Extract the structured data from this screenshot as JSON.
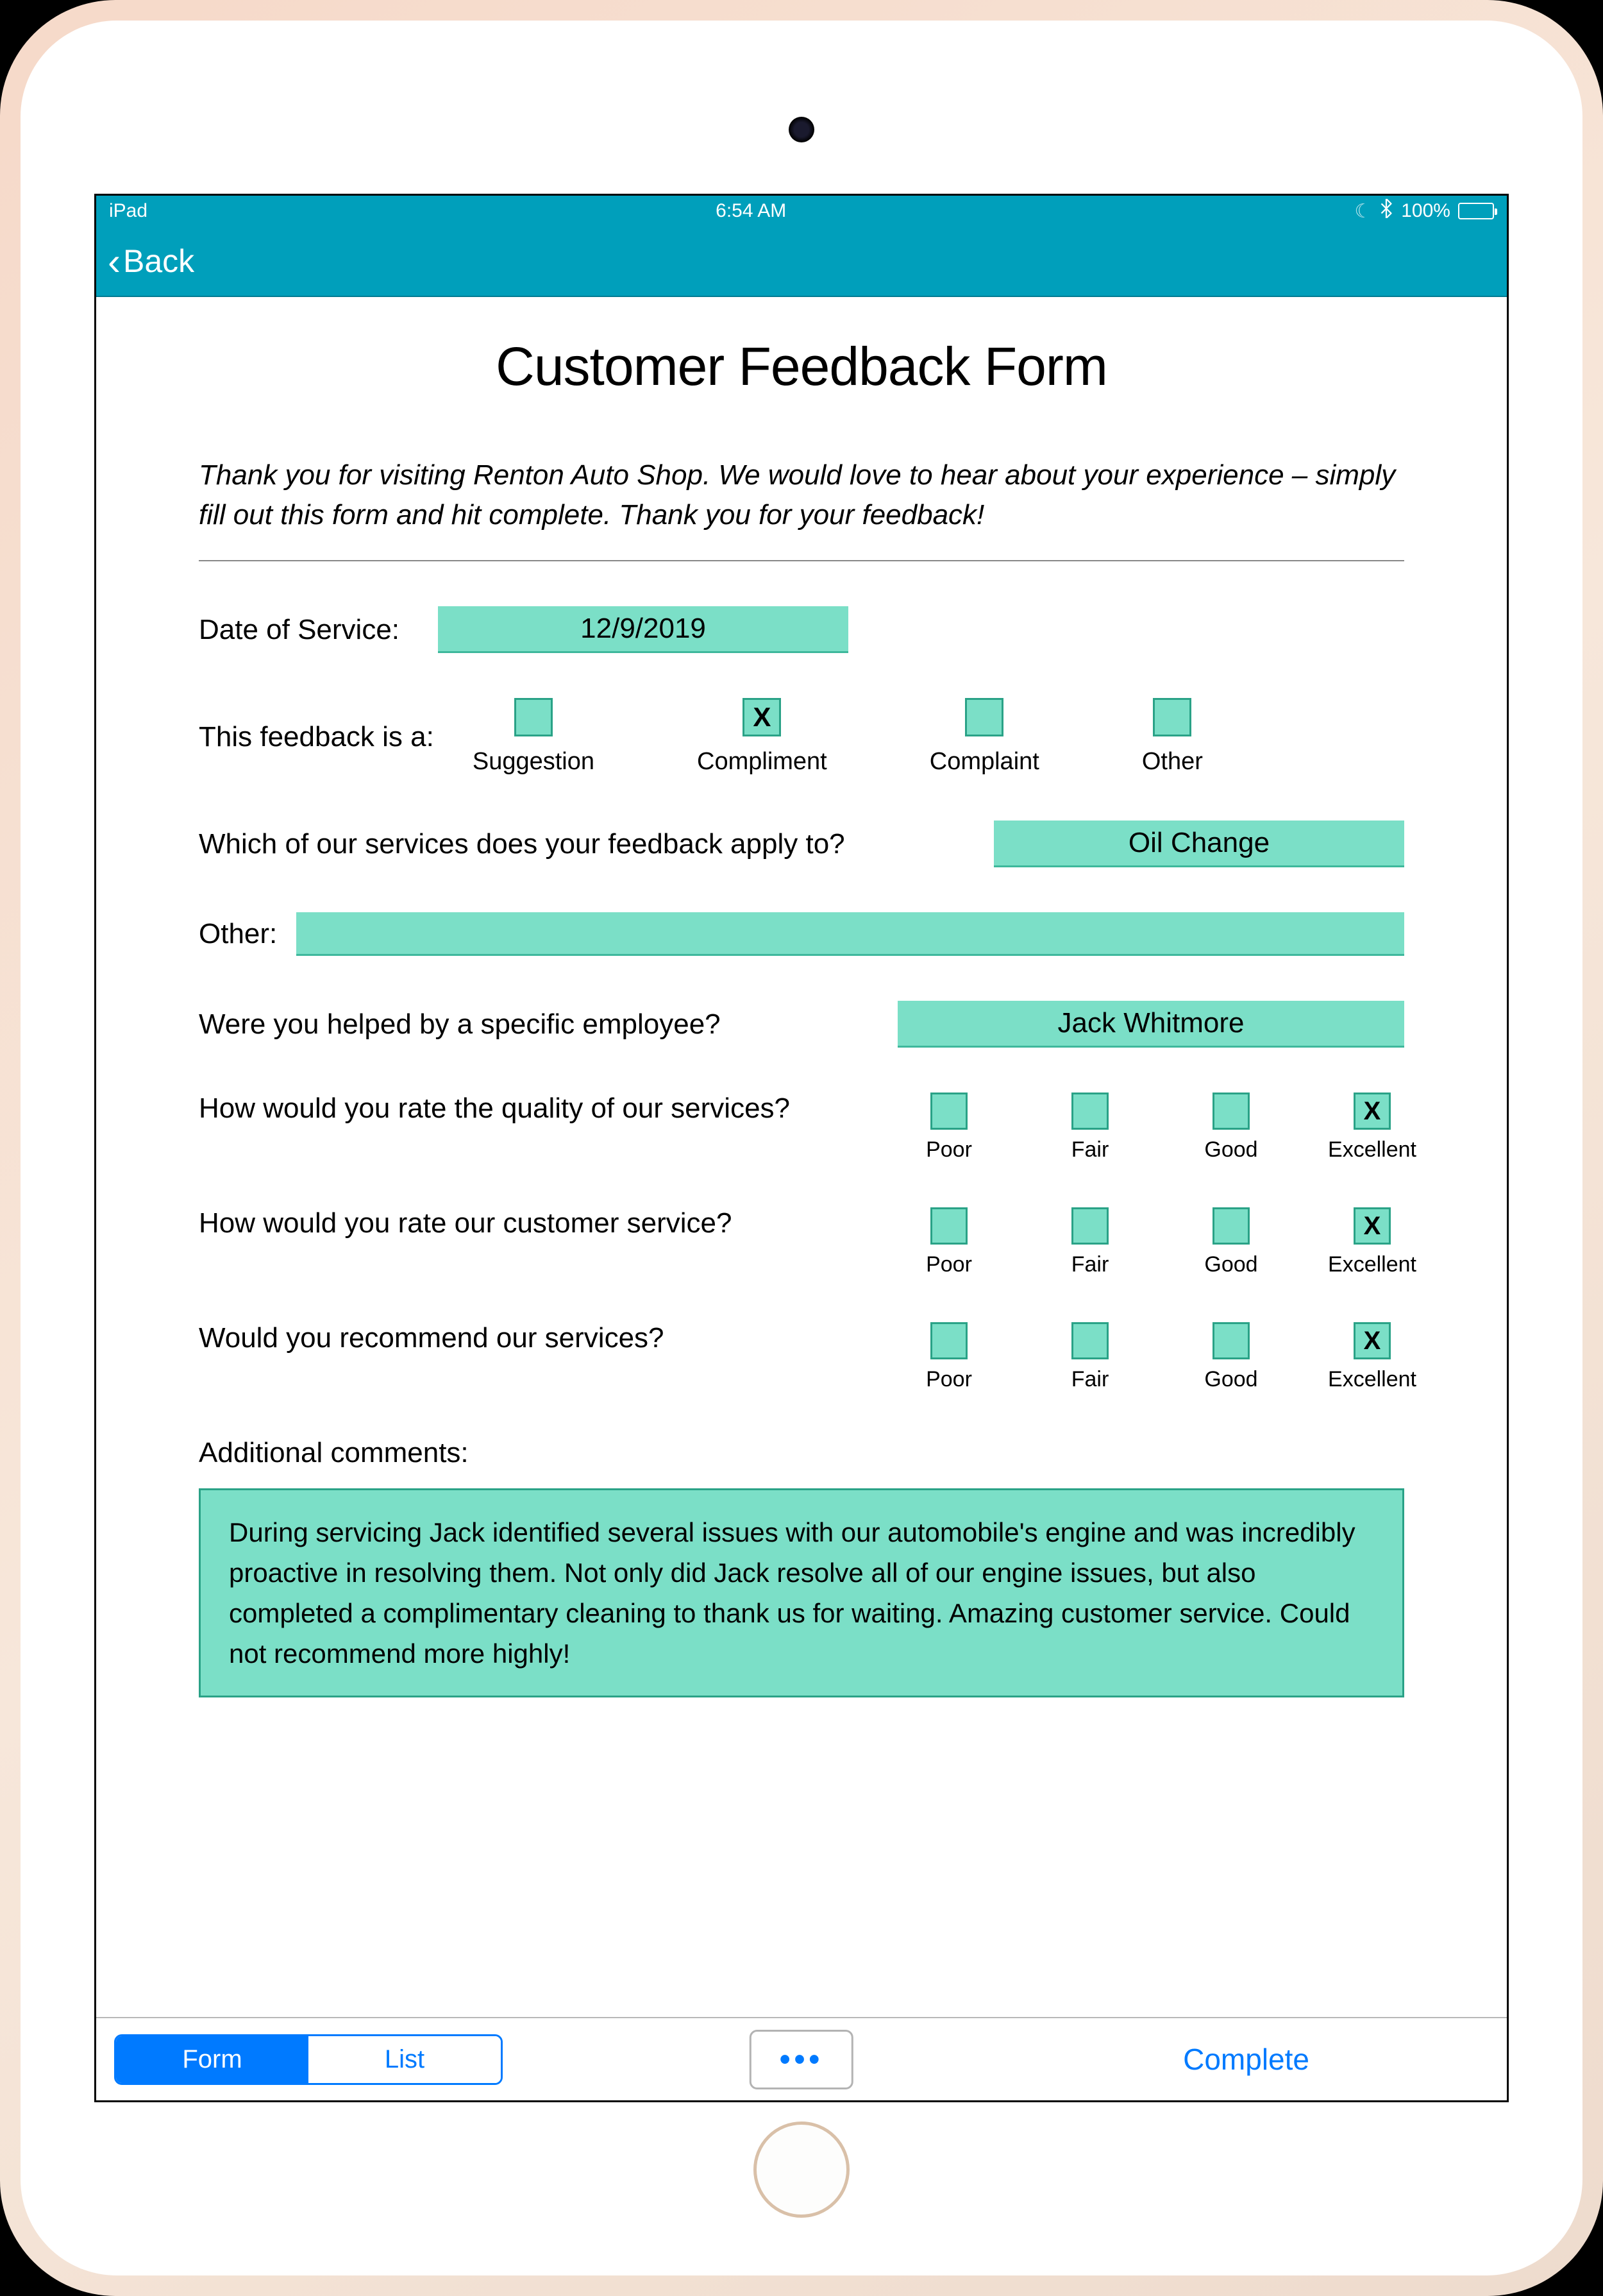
{
  "status": {
    "device": "iPad",
    "time": "6:54 AM",
    "battery": "100%"
  },
  "nav": {
    "back": "Back"
  },
  "form": {
    "title": "Customer Feedback Form",
    "intro": "Thank you for visiting Renton Auto Shop. We would love to hear about your experience – simply fill out this form and hit complete. Thank you for your feedback!",
    "date_label": "Date of Service:",
    "date_value": "12/9/2019",
    "type_label": "This feedback is a:",
    "types": [
      {
        "label": "Suggestion",
        "checked": false
      },
      {
        "label": "Compliment",
        "checked": true
      },
      {
        "label": "Complaint",
        "checked": false
      },
      {
        "label": "Other",
        "checked": false
      }
    ],
    "service_label": "Which of our services does your feedback apply to?",
    "service_value": "Oil Change",
    "other_label": "Other:",
    "other_value": "",
    "employee_label": "Were you helped by a specific employee?",
    "employee_value": "Jack Whitmore",
    "rating_scale": [
      "Poor",
      "Fair",
      "Good",
      "Excellent"
    ],
    "ratings": [
      {
        "question": "How would you rate the quality of our services?",
        "selected": 3
      },
      {
        "question": "How would you rate our customer service?",
        "selected": 3
      },
      {
        "question": "Would you recommend our services?",
        "selected": 3
      }
    ],
    "comments_label": "Additional comments:",
    "comments_value": "During servicing Jack identified several issues with our automobile's engine and was incredibly proactive in resolving them. Not only did Jack resolve all of our engine issues, but also completed a complimentary cleaning to thank us for waiting. Amazing customer service. Could not recommend more highly!"
  },
  "toolbar": {
    "form": "Form",
    "list": "List",
    "more": "•••",
    "complete": "Complete"
  }
}
